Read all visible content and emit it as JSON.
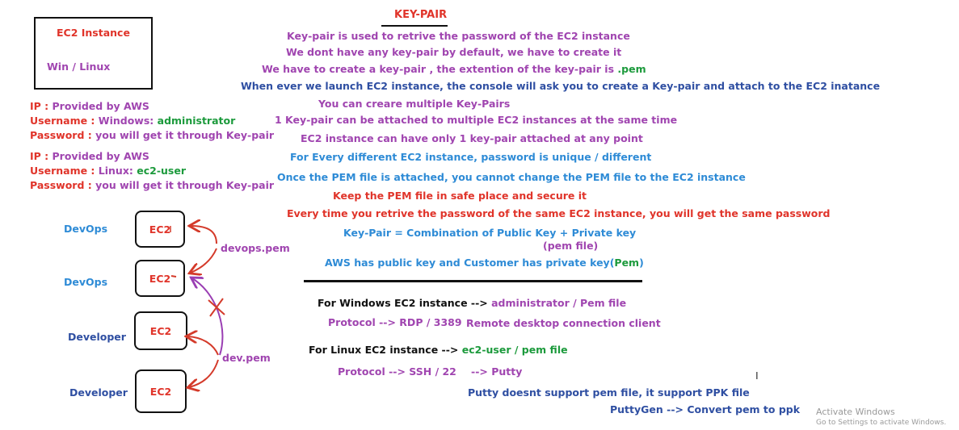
{
  "title": "KEY-PAIR",
  "instance_box": {
    "title": "EC2 Instance",
    "os": "Win / Linux"
  },
  "windows_info": {
    "ip_label": "IP : ",
    "ip_value": "Provided by AWS",
    "user_label": "Username : ",
    "user_value": "Windows: ",
    "user_name": "administrator",
    "pass_label": "Password : ",
    "pass_value": "you will get it through Key-pair"
  },
  "linux_info": {
    "ip_label": "IP : ",
    "ip_value": "Provided by AWS",
    "user_label": "Username : ",
    "user_value": "Linux: ",
    "user_name": "ec2-user",
    "pass_label": "Password : ",
    "pass_value": "you will get it through Key-pair"
  },
  "notes": [
    "Key-pair is used to retrive the password of the EC2 instance",
    "We dont have any key-pair by default, we have to create it",
    "We have to create a key-pair , the extention of the key-pair is ",
    "When ever we launch EC2 instance, the console will ask you to create a Key-pair and attach to the EC2 inatance",
    "You can creare multiple Key-Pairs",
    "1 Key-pair can be attached to multiple EC2 instances at the same time",
    "EC2 instance can have only 1 key-pair attached at any point",
    "For Every different EC2 instance, password is unique / different",
    "Once the PEM file is attached, you cannot change the PEM file to the EC2 instance",
    "Keep the PEM file in safe place and secure it",
    "Every time you retrive the password of the same EC2 instance, you will get the same password",
    "Key-Pair = Combination of Public Key + Private key",
    "(pem file)",
    "AWS has public key and Customer has private key(",
    "Pem",
    ")"
  ],
  "pem_ext": ".pem",
  "diagram": {
    "roles": [
      "DevOps",
      "DevOps",
      "Developer",
      "Developer"
    ],
    "ec2_labels": [
      "EC2",
      "EC2",
      "EC2",
      "EC2"
    ],
    "devops_key": "devops.pem",
    "dev_key": "dev.pem"
  },
  "windows_access": {
    "line1_prefix": "For Windows EC2 instance --> ",
    "line1_value": "administrator / Pem file",
    "protocol": "Protocol --> RDP / 3389",
    "client": "Remote desktop connection client"
  },
  "linux_access": {
    "line1_prefix": "For Linux EC2 instance --> ",
    "line1_value": "ec2-user / pem file",
    "protocol": "Protocol --> SSH / 22",
    "client": "--> Putty",
    "putty_note": "Putty doesnt support pem file, it support PPK file",
    "puttygen": "PuttyGen --> Convert pem to ppk"
  },
  "cursor_glyph": "I",
  "watermark": {
    "line1": "Activate Windows",
    "line2": "Go to Settings to activate Windows."
  }
}
